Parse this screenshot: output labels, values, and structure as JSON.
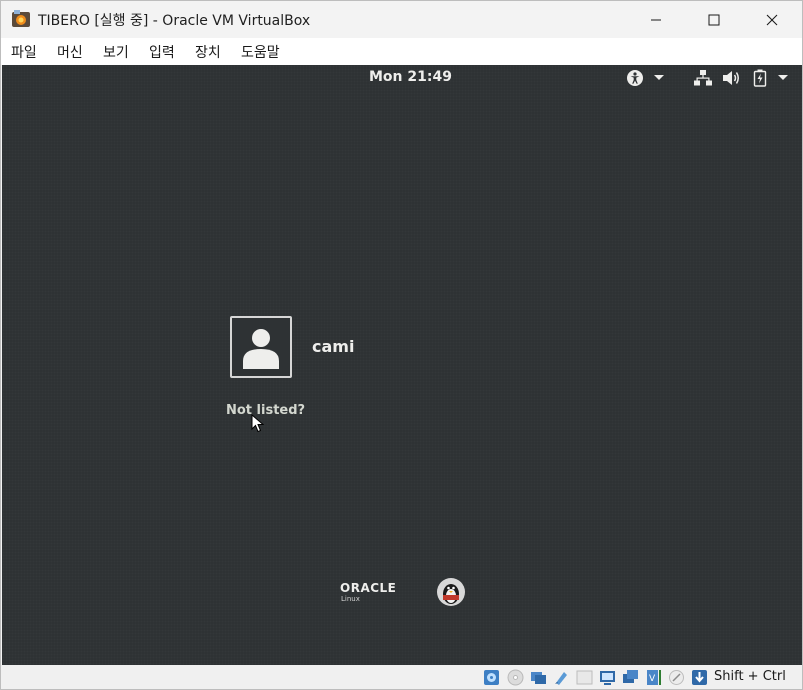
{
  "window": {
    "title": "TIBERO [실행 중] - Oracle VM VirtualBox",
    "controls": [
      "minimize",
      "maximize",
      "close"
    ]
  },
  "menu": {
    "items": [
      "파일",
      "머신",
      "보기",
      "입력",
      "장치",
      "도움말"
    ]
  },
  "guest": {
    "clock": "Mon 21:49",
    "top_icons": [
      "accessibility-icon",
      "chevron-down-icon",
      "network-icon",
      "volume-icon",
      "battery-icon",
      "chevron-down-icon"
    ],
    "user": {
      "name": "cami"
    },
    "not_listed": "Not listed?",
    "branding": {
      "vendor": "ORACLE",
      "product": "Linux"
    },
    "colors": {
      "background": "#2e3234",
      "text": "#eeeeec"
    }
  },
  "statusbar": {
    "icons": [
      "hard-disk-icon",
      "optical-drive-icon",
      "audio-icon",
      "network-adapter-icon",
      "usb-icon",
      "shared-folders-icon",
      "display-icon",
      "video-capture-icon",
      "recording-icon",
      "cpu-icon",
      "mouse-integration-icon",
      "keyboard-capture-icon"
    ],
    "host_key": "Shift + Ctrl"
  }
}
